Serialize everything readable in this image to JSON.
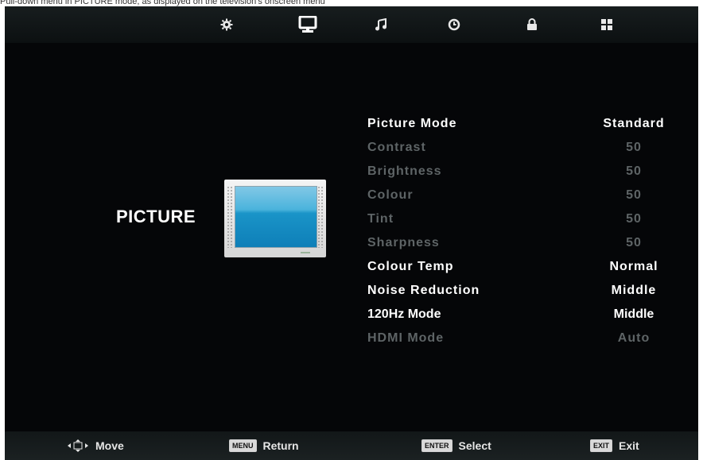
{
  "header_caption": "Pull-down menu in PICTURE mode, as displayed on the television's onscreen menu",
  "tabs": [
    {
      "id": "setup",
      "icon": "gear-icon"
    },
    {
      "id": "picture",
      "icon": "monitor-icon",
      "selected": true
    },
    {
      "id": "sound",
      "icon": "music-note-icon"
    },
    {
      "id": "time",
      "icon": "clock-icon"
    },
    {
      "id": "lock",
      "icon": "lock-icon"
    },
    {
      "id": "channel",
      "icon": "grid-icon"
    }
  ],
  "page_title": "PICTURE",
  "menu": [
    {
      "label": "Picture Mode",
      "value": "Standard",
      "state": "active"
    },
    {
      "label": "Contrast",
      "value": "50",
      "state": "dim"
    },
    {
      "label": "Brightness",
      "value": "50",
      "state": "dim"
    },
    {
      "label": "Colour",
      "value": "50",
      "state": "dim"
    },
    {
      "label": "Tint",
      "value": "50",
      "state": "dim"
    },
    {
      "label": "Sharpness",
      "value": "50",
      "state": "dim"
    },
    {
      "label": "Colour Temp",
      "value": "Normal",
      "state": "active"
    },
    {
      "label": "Noise Reduction",
      "value": "Middle",
      "state": "active"
    },
    {
      "label": "120Hz Mode",
      "value": "Middle",
      "state": "selected"
    },
    {
      "label": "HDMI Mode",
      "value": "Auto",
      "state": "dim"
    }
  ],
  "footer": {
    "move_label": "Move",
    "menu_key": "MENU",
    "return_label": "Return",
    "enter_key": "ENTER",
    "select_label": "Select",
    "exit_key": "EXIT",
    "exit_label": "Exit"
  },
  "colors": {
    "background": "#050608",
    "active_text": "#ffffff",
    "dim_text": "#5e6466",
    "screen_blue": "#1a94c8"
  }
}
